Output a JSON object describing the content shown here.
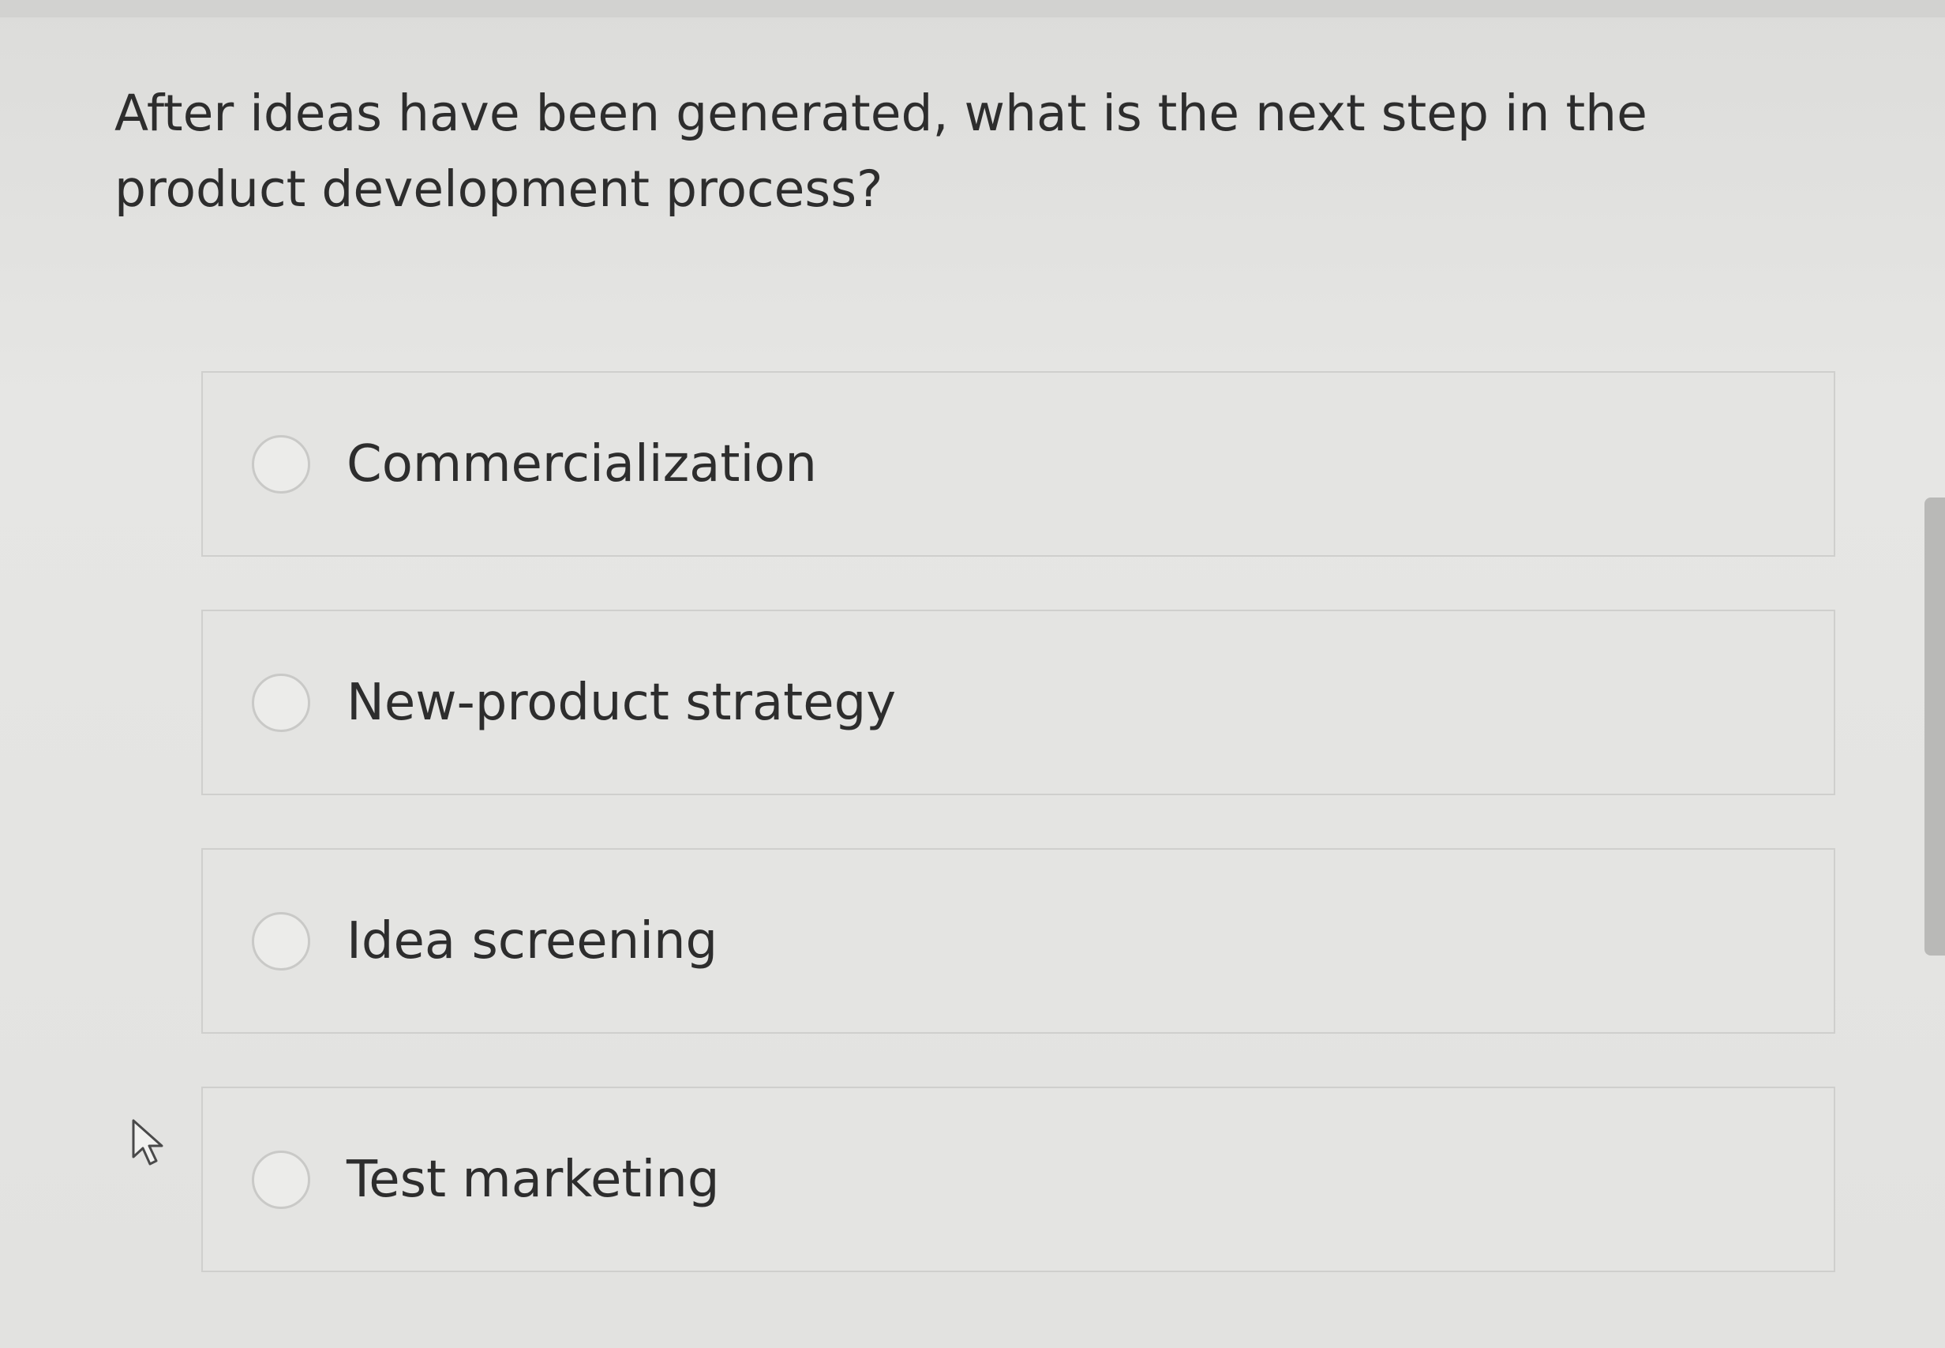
{
  "question": {
    "text": "After ideas have been generated, what is the next step in the product development process?"
  },
  "options": [
    {
      "label": "Commercialization",
      "selected": false
    },
    {
      "label": "New-product strategy",
      "selected": false
    },
    {
      "label": "Idea screening",
      "selected": false
    },
    {
      "label": "Test marketing",
      "selected": false
    }
  ],
  "icons": {
    "radio": "radio-button-unselected",
    "cursor": "mouse-pointer-icon"
  },
  "colors": {
    "background": "#e3e3e1",
    "text": "#2d2d2d",
    "option_border": "#cfcfcd",
    "radio_border": "#c9c9c7"
  }
}
